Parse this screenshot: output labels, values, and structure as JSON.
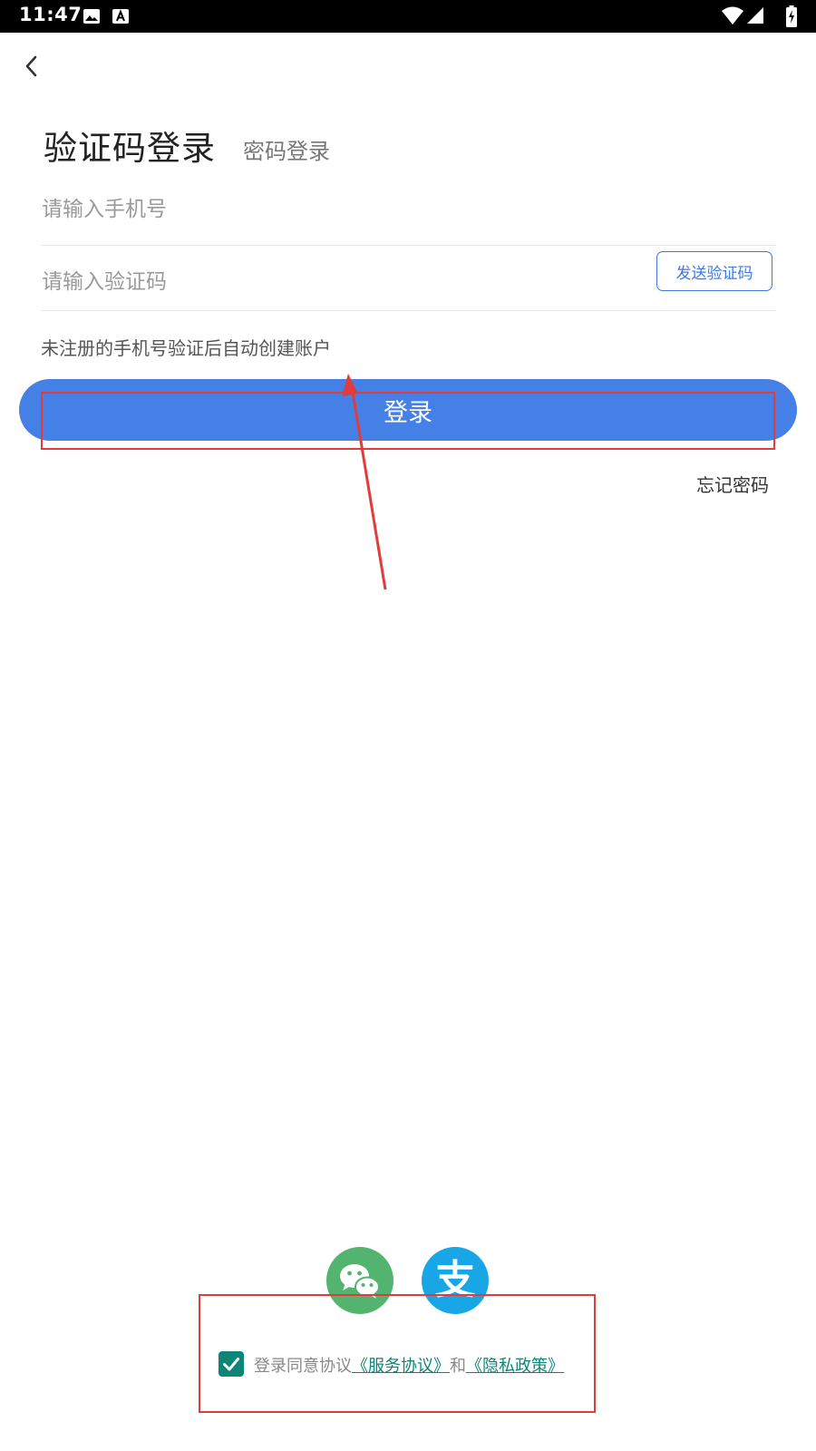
{
  "status_bar": {
    "time": "11:47",
    "icons": [
      "image-icon",
      "text-a-icon",
      "wifi-icon",
      "signal-icon",
      "battery-charging-icon"
    ]
  },
  "nav": {
    "back_icon": "chevron-left-icon"
  },
  "tabs": {
    "active_label": "验证码登录",
    "inactive_label": "密码登录"
  },
  "form": {
    "phone_placeholder": "请输入手机号",
    "code_placeholder": "请输入验证码",
    "send_code_label": "发送验证码",
    "hint": "未注册的手机号验证后自动创建账户",
    "login_label": "登录",
    "forgot_password": "忘记密码"
  },
  "social": {
    "wechat_icon": "wechat-icon",
    "alipay_icon": "alipay-icon",
    "alipay_glyph": "支"
  },
  "agreement": {
    "checked": true,
    "prefix": "登录同意协议",
    "service_link": "《服务协议》",
    "connector": "和",
    "privacy_link": "《隐私政策》"
  },
  "colors": {
    "primary": "#4480e6",
    "send_code_accent": "#3f78e0",
    "wechat": "#52b46e",
    "alipay": "#18a6e7",
    "agreement_accent": "#0d8577",
    "annotation": "#e03c3c"
  }
}
